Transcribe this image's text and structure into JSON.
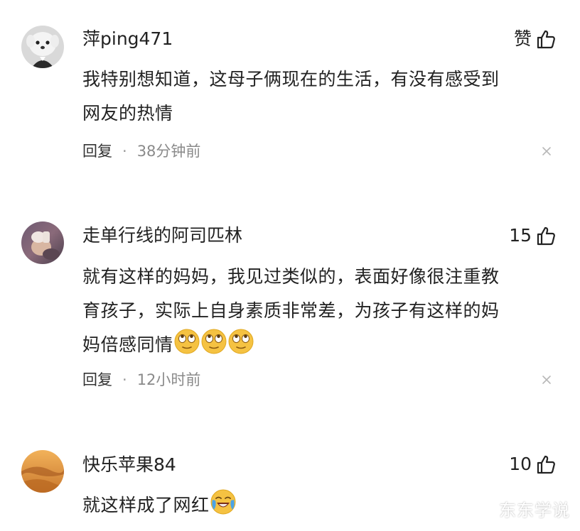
{
  "comments": [
    {
      "username": "萍ping471",
      "like_label": "赞",
      "text_lines": [
        "我特别想知道，这母子俩现在的生活，有没有感受到",
        "网友的热情"
      ],
      "reply_label": "回复",
      "dot": "·",
      "time": "38分钟前",
      "avatar_icon": "white-dog-avatar"
    },
    {
      "username": "走单行线的阿司匹林",
      "like_label": "15",
      "text_lines": [
        "就有这样的妈妈，我见过类似的，表面好像很注重教",
        "育孩子，实际上自身素质非常差，为孩子有这样的妈",
        "妈倍感同情"
      ],
      "reply_label": "回复",
      "dot": "·",
      "time": "12小时前",
      "avatar_icon": "photo-avatar",
      "emoji_icon": "eye-roll-emoji"
    },
    {
      "username": "快乐苹果84",
      "like_label": "10",
      "text_lines": [
        "就这样成了网红"
      ],
      "avatar_icon": "desert-dune-avatar",
      "emoji_icon": "crying-laughing-emoji"
    }
  ],
  "watermark": "东东学说",
  "colors": {
    "text": "#222222",
    "meta": "#8a8a8a",
    "close": "#b8b8b8",
    "emoji": "#f5c242"
  }
}
